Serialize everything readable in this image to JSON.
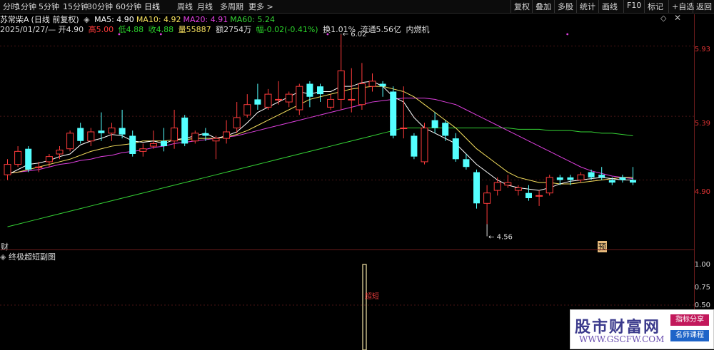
{
  "tabs": [
    "分时",
    "1分钟",
    "5分钟",
    "15分钟",
    "30分钟",
    "60分钟",
    "日线",
    "周线",
    "月线",
    "多周期",
    "更多 >"
  ],
  "active_tab": "日线",
  "tools": [
    "复权",
    "叠加",
    "多股",
    "统计",
    "画线",
    "F10",
    "标记",
    "+自选",
    "返回"
  ],
  "stock": {
    "name": "苏常柴A",
    "mode": "(日线 前复权)"
  },
  "ma": [
    {
      "label": "MA5:",
      "value": "4.90",
      "color": "#ffffff"
    },
    {
      "label": "MA10:",
      "value": "4.92",
      "color": "#f6e05e"
    },
    {
      "label": "MA20:",
      "value": "4.91",
      "color": "#e040e0"
    },
    {
      "label": "MA60:",
      "value": "5.24",
      "color": "#35d335"
    }
  ],
  "info": {
    "date": "2025/01/27/—",
    "open_l": "开",
    "open": "4.90",
    "high_l": "高",
    "high": "5.00",
    "low_l": "低",
    "low": "4.88",
    "close_l": "收",
    "close": "4.88",
    "vol_l": "量",
    "vol": "55887",
    "amt_l": "额",
    "amt": "2754万",
    "chg_l": "幅",
    "chg": "-0.02(-0.41%)",
    "turn_l": "换",
    "turn": "1.01%",
    "float_l": "流通",
    "float": "5.56亿",
    "sector": "内燃机"
  },
  "yaxis": [
    "5.93",
    "5.39",
    "4.90"
  ],
  "annotations": {
    "high": "6.02",
    "low": "4.56"
  },
  "markers": {
    "left": "财",
    "right": "预"
  },
  "sub": {
    "title": "终极超短副图",
    "ticks": [
      "1.00",
      "0.75",
      "0.50"
    ],
    "signal": "超短"
  },
  "chart_data": {
    "type": "candlestick",
    "ylim": [
      4.42,
      6.12
    ],
    "candles": [
      [
        4.94,
        5.02,
        4.9,
        5.06
      ],
      [
        5.02,
        5.12,
        5.0,
        5.16
      ],
      [
        5.14,
        4.98,
        4.96,
        5.16
      ],
      [
        5.0,
        5.0,
        4.96,
        5.04
      ],
      [
        5.04,
        5.08,
        5.0,
        5.1
      ],
      [
        5.1,
        5.13,
        5.06,
        5.16
      ],
      [
        5.14,
        5.26,
        5.12,
        5.28
      ],
      [
        5.3,
        5.2,
        5.18,
        5.34
      ],
      [
        5.2,
        5.27,
        5.16,
        5.3
      ],
      [
        5.28,
        5.26,
        5.2,
        5.42
      ],
      [
        5.26,
        5.3,
        5.2,
        5.34
      ],
      [
        5.3,
        5.25,
        5.22,
        5.44
      ],
      [
        5.24,
        5.1,
        5.08,
        5.28
      ],
      [
        5.12,
        5.14,
        5.08,
        5.18
      ],
      [
        5.16,
        5.18,
        5.14,
        5.28
      ],
      [
        5.2,
        5.16,
        5.12,
        5.3
      ],
      [
        5.2,
        5.3,
        5.14,
        5.44
      ],
      [
        5.38,
        5.18,
        5.16,
        5.4
      ],
      [
        5.2,
        5.26,
        5.18,
        5.28
      ],
      [
        5.26,
        5.24,
        5.2,
        5.3
      ],
      [
        5.2,
        5.22,
        5.06,
        5.24
      ],
      [
        5.22,
        5.27,
        5.18,
        5.36
      ],
      [
        5.3,
        5.38,
        5.26,
        5.5
      ],
      [
        5.4,
        5.48,
        5.38,
        5.56
      ],
      [
        5.52,
        5.48,
        5.44,
        5.64
      ],
      [
        5.46,
        5.56,
        5.44,
        5.6
      ],
      [
        5.52,
        5.52,
        5.48,
        5.66
      ],
      [
        5.5,
        5.56,
        5.46,
        5.58
      ],
      [
        5.44,
        5.62,
        5.4,
        5.64
      ],
      [
        5.64,
        5.54,
        5.46,
        5.66
      ],
      [
        5.62,
        5.56,
        5.5,
        5.64
      ],
      [
        5.46,
        5.52,
        5.44,
        5.56
      ],
      [
        5.52,
        5.74,
        5.44,
        6.02
      ],
      [
        5.52,
        5.52,
        5.42,
        5.76
      ],
      [
        5.48,
        5.64,
        5.44,
        5.8
      ],
      [
        5.62,
        5.66,
        5.58,
        5.72
      ],
      [
        5.64,
        5.62,
        5.54,
        5.66
      ],
      [
        5.58,
        5.24,
        5.22,
        5.62
      ],
      [
        5.3,
        5.3,
        5.22,
        5.62
      ],
      [
        5.24,
        5.08,
        5.06,
        5.26
      ],
      [
        5.04,
        5.3,
        5.02,
        5.34
      ],
      [
        5.36,
        5.3,
        5.26,
        5.42
      ],
      [
        5.34,
        5.24,
        5.2,
        5.36
      ],
      [
        5.22,
        5.06,
        5.04,
        5.26
      ],
      [
        5.06,
        5.0,
        4.98,
        5.1
      ],
      [
        4.96,
        4.72,
        4.68,
        4.98
      ],
      [
        4.72,
        4.8,
        4.56,
        4.86
      ],
      [
        4.82,
        4.88,
        4.78,
        4.92
      ],
      [
        4.86,
        4.88,
        4.84,
        4.94
      ],
      [
        4.82,
        4.84,
        4.78,
        4.86
      ],
      [
        4.8,
        4.76,
        4.74,
        4.86
      ],
      [
        4.78,
        4.78,
        4.7,
        4.82
      ],
      [
        4.8,
        4.92,
        4.78,
        4.94
      ],
      [
        4.92,
        4.9,
        4.86,
        4.94
      ],
      [
        4.92,
        4.9,
        4.86,
        4.94
      ],
      [
        4.9,
        4.94,
        4.88,
        4.96
      ],
      [
        4.96,
        4.92,
        4.9,
        4.98
      ],
      [
        4.94,
        4.92,
        4.9,
        5.0
      ],
      [
        4.9,
        4.88,
        4.86,
        4.92
      ],
      [
        4.92,
        4.9,
        4.88,
        4.94
      ],
      [
        4.9,
        4.88,
        4.86,
        5.0
      ]
    ],
    "ma5": [
      4.94,
      4.98,
      5.02,
      5.03,
      5.05,
      5.08,
      5.1,
      5.17,
      5.2,
      5.22,
      5.25,
      5.24,
      5.2,
      5.19,
      5.2,
      5.18,
      5.21,
      5.22,
      5.24,
      5.26,
      5.22,
      5.24,
      5.27,
      5.34,
      5.42,
      5.46,
      5.5,
      5.54,
      5.58,
      5.56,
      5.58,
      5.58,
      5.62,
      5.62,
      5.65,
      5.66,
      5.62,
      5.54,
      5.5,
      5.38,
      5.3,
      5.26,
      5.22,
      5.18,
      5.1,
      5.02,
      4.96,
      4.9,
      4.86,
      4.84,
      4.83,
      4.82,
      4.84,
      4.87,
      4.89,
      4.9,
      4.91,
      4.92,
      4.91,
      4.9,
      4.9
    ],
    "ma10": [
      4.95,
      4.96,
      4.98,
      5.0,
      5.02,
      5.04,
      5.06,
      5.09,
      5.12,
      5.14,
      5.16,
      5.17,
      5.18,
      5.2,
      5.2,
      5.2,
      5.21,
      5.21,
      5.22,
      5.22,
      5.22,
      5.23,
      5.25,
      5.28,
      5.32,
      5.36,
      5.4,
      5.44,
      5.48,
      5.52,
      5.54,
      5.56,
      5.58,
      5.6,
      5.61,
      5.62,
      5.62,
      5.6,
      5.58,
      5.54,
      5.48,
      5.42,
      5.36,
      5.3,
      5.22,
      5.14,
      5.08,
      5.02,
      4.96,
      4.92,
      4.9,
      4.88,
      4.88,
      4.87,
      4.87,
      4.88,
      4.89,
      4.9,
      4.91,
      4.92,
      4.92
    ],
    "ma20": [
      4.95,
      4.96,
      4.97,
      4.98,
      5.0,
      5.02,
      5.03,
      5.05,
      5.06,
      5.08,
      5.09,
      5.11,
      5.12,
      5.13,
      5.15,
      5.16,
      5.18,
      5.19,
      5.2,
      5.21,
      5.22,
      5.23,
      5.24,
      5.26,
      5.28,
      5.3,
      5.32,
      5.34,
      5.36,
      5.38,
      5.4,
      5.42,
      5.44,
      5.46,
      5.48,
      5.5,
      5.51,
      5.52,
      5.53,
      5.53,
      5.53,
      5.52,
      5.5,
      5.48,
      5.44,
      5.4,
      5.36,
      5.32,
      5.28,
      5.24,
      5.2,
      5.16,
      5.12,
      5.08,
      5.04,
      5.0,
      4.97,
      4.95,
      4.93,
      4.92,
      4.91
    ],
    "ma60": [
      4.54,
      4.56,
      4.58,
      4.6,
      4.62,
      4.64,
      4.66,
      4.68,
      4.7,
      4.72,
      4.74,
      4.76,
      4.78,
      4.8,
      4.82,
      4.84,
      4.86,
      4.88,
      4.9,
      4.92,
      4.94,
      4.96,
      4.98,
      5.0,
      5.02,
      5.04,
      5.06,
      5.08,
      5.1,
      5.12,
      5.14,
      5.16,
      5.18,
      5.2,
      5.22,
      5.24,
      5.26,
      5.28,
      5.3,
      5.3,
      5.3,
      5.3,
      5.3,
      5.3,
      5.3,
      5.3,
      5.3,
      5.3,
      5.3,
      5.29,
      5.29,
      5.29,
      5.28,
      5.28,
      5.28,
      5.27,
      5.27,
      5.26,
      5.26,
      5.25,
      5.24
    ]
  }
}
